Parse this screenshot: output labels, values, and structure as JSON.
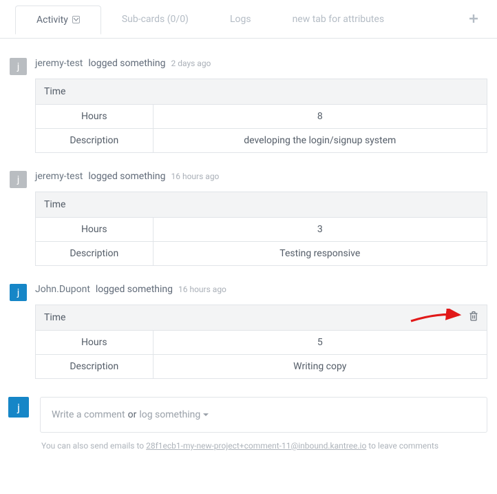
{
  "tabs": {
    "activity": "Activity",
    "subcards": "Sub-cards (0/0)",
    "logs": "Logs",
    "attributes": "new tab for attributes"
  },
  "entries": [
    {
      "avatar": "j",
      "avatar_color": "gray",
      "user": "jeremy-test",
      "action": "logged something",
      "time": "2 days ago",
      "header": "Time",
      "rows": {
        "hours_label": "Hours",
        "hours_value": "8",
        "desc_label": "Description",
        "desc_value": "developing the login/signup system"
      },
      "show_trash": false
    },
    {
      "avatar": "j",
      "avatar_color": "gray",
      "user": "jeremy-test",
      "action": "logged something",
      "time": "16 hours ago",
      "header": "Time",
      "rows": {
        "hours_label": "Hours",
        "hours_value": "3",
        "desc_label": "Description",
        "desc_value": "Testing responsive"
      },
      "show_trash": false
    },
    {
      "avatar": "j",
      "avatar_color": "blue",
      "user": "John.Dupont",
      "action": "logged something",
      "time": "16 hours ago",
      "header": "Time",
      "rows": {
        "hours_label": "Hours",
        "hours_value": "5",
        "desc_label": "Description",
        "desc_value": "Writing copy"
      },
      "show_trash": true
    }
  ],
  "composer": {
    "avatar": "j",
    "write": "Write a comment",
    "or": "or",
    "log": "log something"
  },
  "hint": {
    "prefix": "You can also send emails to ",
    "email": "28f1ecb1-my-new-project+comment-11@inbound.kantree.io",
    "suffix": " to leave comments"
  }
}
